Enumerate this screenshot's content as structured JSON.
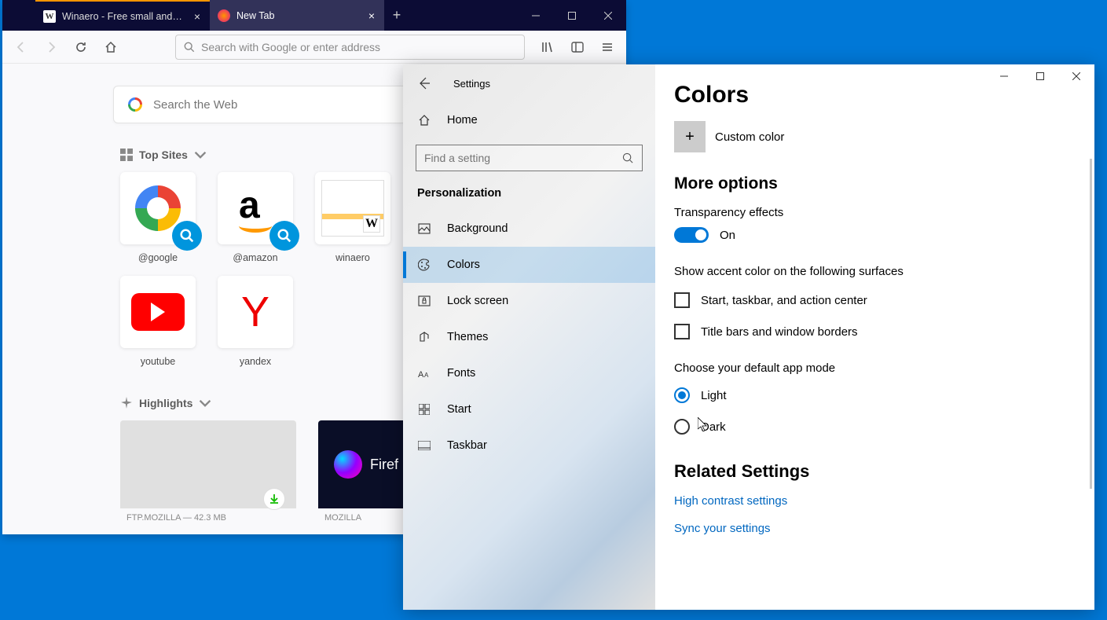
{
  "firefox": {
    "tabs": [
      {
        "title": "Winaero - Free small and usefu",
        "active": false
      },
      {
        "title": "New Tab",
        "active": true
      }
    ],
    "urlbar_placeholder": "Search with Google or enter address",
    "search_placeholder": "Search the Web",
    "top_sites_label": "Top Sites",
    "highlights_label": "Highlights",
    "tiles_row1": [
      {
        "label": "@google"
      },
      {
        "label": "@amazon"
      },
      {
        "label": "winaero"
      }
    ],
    "tiles_row2": [
      {
        "label": "youtube"
      },
      {
        "label": "yandex"
      }
    ],
    "highlight1_text": "FTP.MOZILLA — 42.3 MB",
    "highlight2_brand": "Firef",
    "highlight2_text": "MOZILLA"
  },
  "settings": {
    "header": "Settings",
    "home_label": "Home",
    "search_placeholder": "Find a setting",
    "section": "Personalization",
    "items": [
      {
        "label": "Background"
      },
      {
        "label": "Colors"
      },
      {
        "label": "Lock screen"
      },
      {
        "label": "Themes"
      },
      {
        "label": "Fonts"
      },
      {
        "label": "Start"
      },
      {
        "label": "Taskbar"
      }
    ],
    "page_title": "Colors",
    "custom_color": "Custom color",
    "more_options": "More options",
    "transparency_label": "Transparency effects",
    "transparency_state": "On",
    "accent_heading": "Show accent color on the following surfaces",
    "check1": "Start, taskbar, and action center",
    "check2": "Title bars and window borders",
    "mode_heading": "Choose your default app mode",
    "mode_light": "Light",
    "mode_dark": "Dark",
    "related_heading": "Related Settings",
    "link1": "High contrast settings",
    "link2": "Sync your settings"
  }
}
